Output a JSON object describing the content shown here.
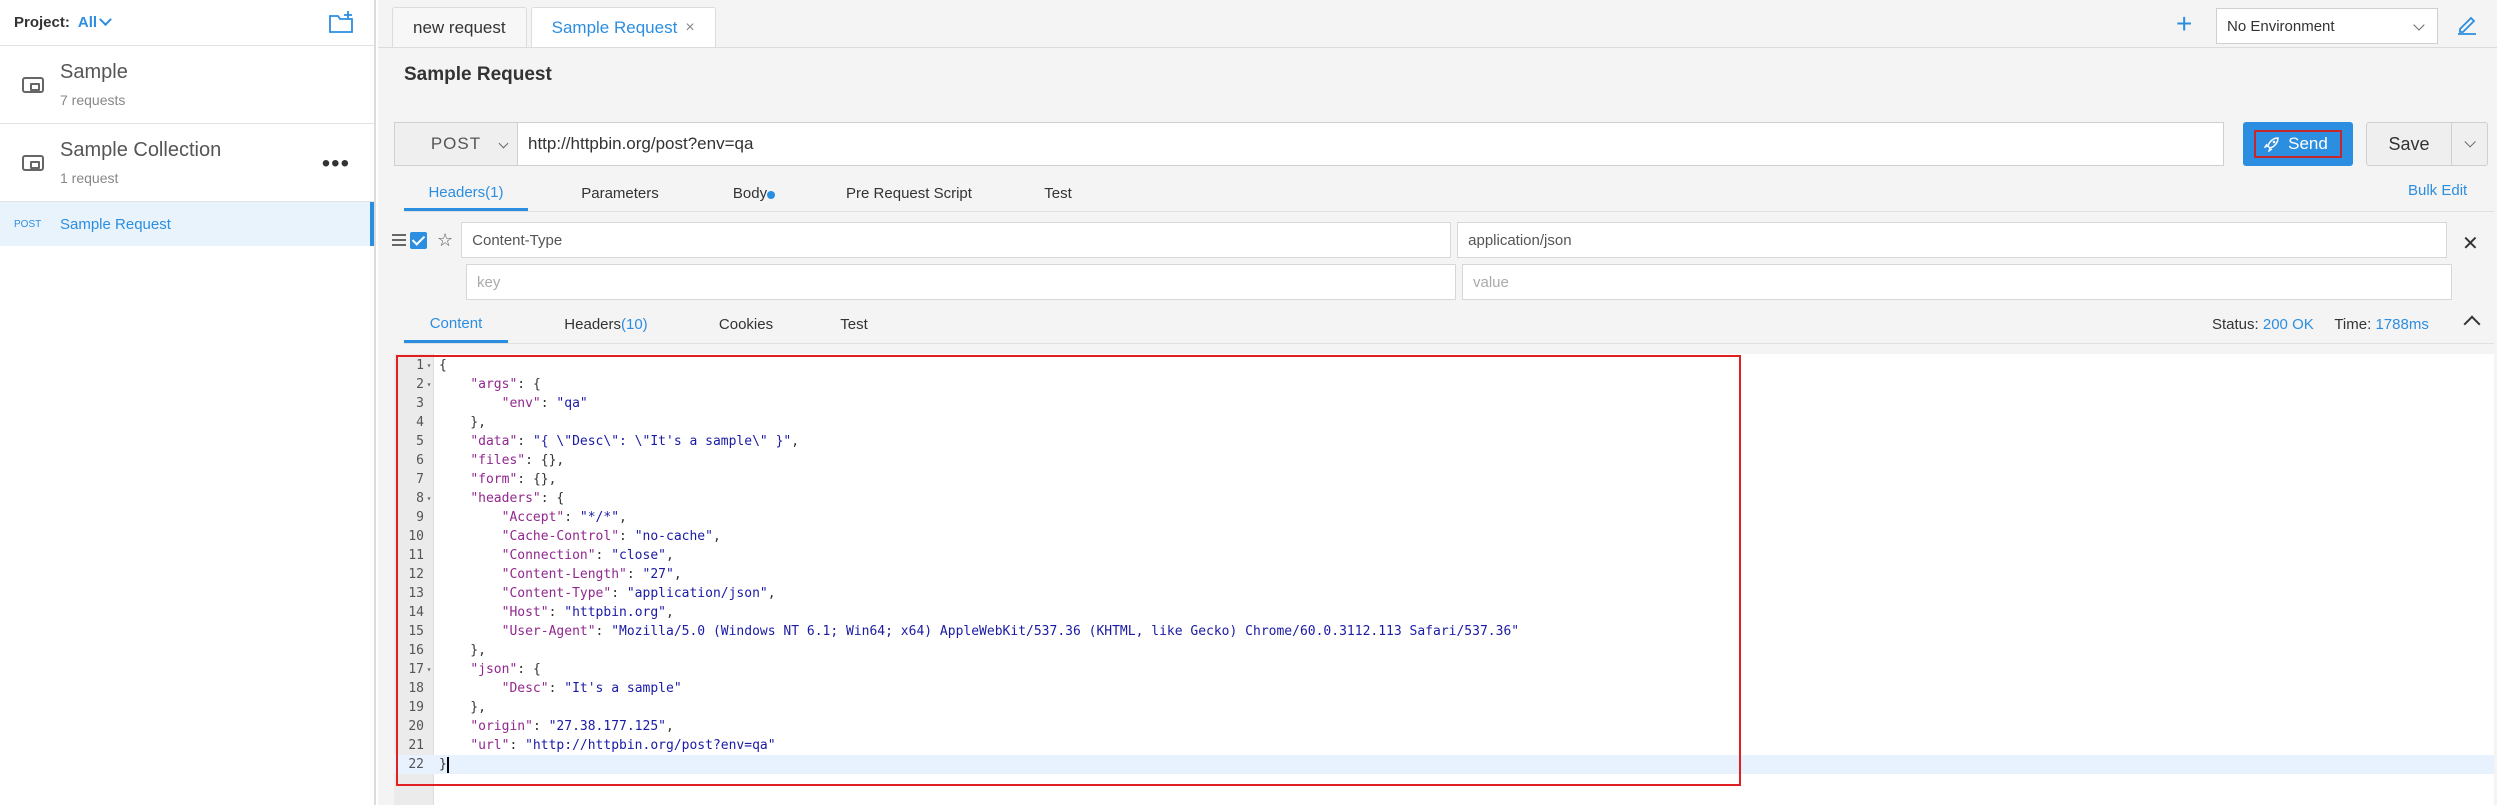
{
  "sidebar": {
    "project_label": "Project:",
    "project_value": "All",
    "collections": [
      {
        "name": "Sample",
        "count": "7 requests"
      },
      {
        "name": "Sample Collection",
        "count": "1 request"
      }
    ],
    "active_request": {
      "method": "POST",
      "name": "Sample Request"
    }
  },
  "tabs": [
    {
      "label": "new request"
    },
    {
      "label": "Sample Request",
      "close": "×"
    }
  ],
  "environment": {
    "selected": "No Environment"
  },
  "request": {
    "title": "Sample Request",
    "method": "POST",
    "url": "http://httpbin.org/post?env=qa",
    "send_label": "Send",
    "save_label": "Save",
    "tabs": {
      "headers": "Headers",
      "headers_count": "(1)",
      "parameters": "Parameters",
      "body": "Body",
      "pre_request": "Pre Request Script",
      "test": "Test"
    },
    "bulk_edit": "Bulk Edit",
    "headers": [
      {
        "key": "Content-Type",
        "value": "application/json"
      }
    ],
    "new_header": {
      "key_placeholder": "key",
      "value_placeholder": "value"
    }
  },
  "response": {
    "tabs": {
      "content": "Content",
      "headers": "Headers",
      "headers_count": "(10)",
      "cookies": "Cookies",
      "test": "Test"
    },
    "status_label": "Status:",
    "status_value": "200 OK",
    "time_label": "Time:",
    "time_value": "1788ms",
    "code_lines": [
      "{",
      "    \"args\": {",
      "        \"env\": \"qa\"",
      "    },",
      "    \"data\": \"{ \\\"Desc\\\": \\\"It's a sample\\\" }\",",
      "    \"files\": {},",
      "    \"form\": {},",
      "    \"headers\": {",
      "        \"Accept\": \"*/*\",",
      "        \"Cache-Control\": \"no-cache\",",
      "        \"Connection\": \"close\",",
      "        \"Content-Length\": \"27\",",
      "        \"Content-Type\": \"application/json\",",
      "        \"Host\": \"httpbin.org\",",
      "        \"User-Agent\": \"Mozilla/5.0 (Windows NT 6.1; Win64; x64) AppleWebKit/537.36 (KHTML, like Gecko) Chrome/60.0.3112.113 Safari/537.36\"",
      "    },",
      "    \"json\": {",
      "        \"Desc\": \"It's a sample\"",
      "    },",
      "    \"origin\": \"27.38.177.125\",",
      "    \"url\": \"http://httpbin.org/post?env=qa\"",
      "}"
    ],
    "fold_lines": [
      1,
      2,
      8,
      17
    ]
  }
}
